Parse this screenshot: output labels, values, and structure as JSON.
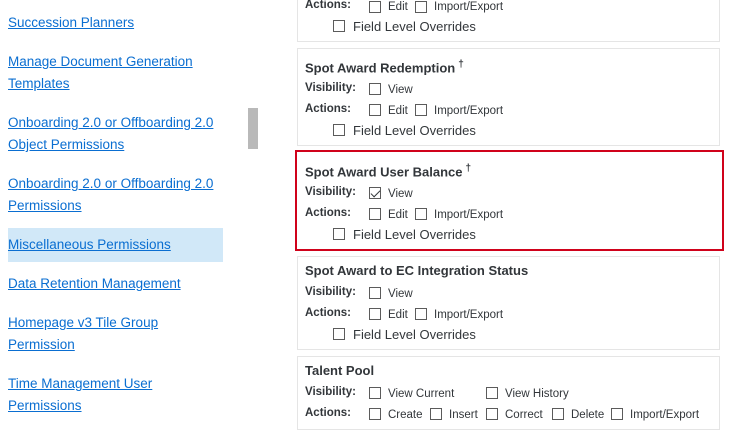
{
  "nav": {
    "items": [
      {
        "label": "Succession Planners"
      },
      {
        "label": "Manage Document Generation Templates"
      },
      {
        "label": "Onboarding 2.0 or Offboarding 2.0 Object Permissions"
      },
      {
        "label": "Onboarding 2.0 or Offboarding 2.0 Permissions"
      },
      {
        "label": "Miscellaneous Permissions",
        "active": true
      },
      {
        "label": "Data Retention Management"
      },
      {
        "label": "Homepage v3 Tile Group Permission"
      },
      {
        "label": "Time Management User Permissions"
      }
    ]
  },
  "labels": {
    "visibility": "Visibility:",
    "actions": "Actions:",
    "view": "View",
    "edit": "Edit",
    "import_export": "Import/Export",
    "field_level_overrides": "Field Level Overrides",
    "dagger": "†"
  },
  "panels": {
    "top_partial": {
      "actions_label": "Actions:"
    },
    "spot_award_redemption": {
      "title": "Spot Award Redemption",
      "view_checked": false
    },
    "spot_award_user_balance": {
      "title": "Spot Award User Balance",
      "view_checked": true
    },
    "spot_award_ec_integration": {
      "title": "Spot Award to EC Integration Status",
      "view_checked": false
    },
    "talent_pool": {
      "title": "Talent Pool",
      "view_current": "View Current",
      "view_history": "View History",
      "actions": [
        "Create",
        "Insert",
        "Correct",
        "Delete",
        "Import/Export"
      ]
    }
  },
  "colors": {
    "link": "#0a6ed1",
    "active_bg": "#d1e8f8",
    "highlight_border": "#d0021b"
  }
}
